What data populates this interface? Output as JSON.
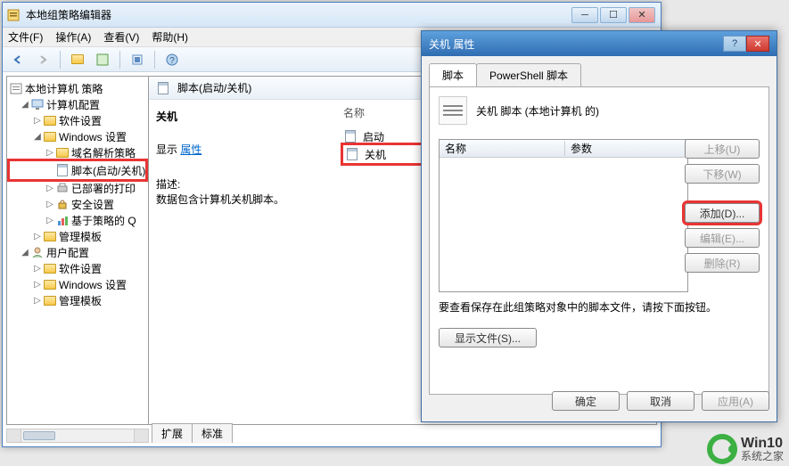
{
  "main": {
    "title": "本地组策略编辑器",
    "menus": [
      {
        "label": "文件(F)"
      },
      {
        "label": "操作(A)"
      },
      {
        "label": "查看(V)"
      },
      {
        "label": "帮助(H)"
      }
    ],
    "tree": {
      "root": "本地计算机 策略",
      "computer_config": "计算机配置",
      "software_settings": "软件设置",
      "windows_settings": "Windows 设置",
      "dns_policy": "域名解析策略",
      "scripts": "脚本(启动/关机)",
      "deployed_printers": "已部署的打印",
      "security_settings": "安全设置",
      "policy_based": "基于策略的 Q",
      "admin_templates_c": "管理模板",
      "user_config": "用户配置",
      "software_settings_u": "软件设置",
      "windows_settings_u": "Windows 设置",
      "admin_templates_u": "管理模板"
    },
    "content_header": "脚本(启动/关机)",
    "left_panel": {
      "title": "关机",
      "show_label": "显示",
      "properties_link": "属性",
      "desc_label": "描述:",
      "desc_text": "数据包含计算机关机脚本。"
    },
    "right_panel": {
      "col_name": "名称",
      "items": [
        {
          "name": "启动"
        },
        {
          "name": "关机"
        }
      ]
    },
    "tabs": {
      "extended": "扩展",
      "standard": "标准"
    }
  },
  "dialog": {
    "title": "关机 属性",
    "tabs": {
      "scripts": "脚本",
      "powershell": "PowerShell 脚本"
    },
    "header_text": "关机 脚本 (本地计算机 的)",
    "list_cols": {
      "name": "名称",
      "params": "参数"
    },
    "buttons": {
      "move_up": "上移(U)",
      "move_down": "下移(W)",
      "add": "添加(D)...",
      "edit": "编辑(E)...",
      "remove": "删除(R)"
    },
    "hint": "要查看保存在此组策略对象中的脚本文件，请按下面按钮。",
    "show_files": "显示文件(S)...",
    "ok": "确定",
    "cancel": "取消",
    "apply": "应用(A)"
  },
  "watermark": {
    "top": "Win10",
    "bottom": "系统之家"
  }
}
